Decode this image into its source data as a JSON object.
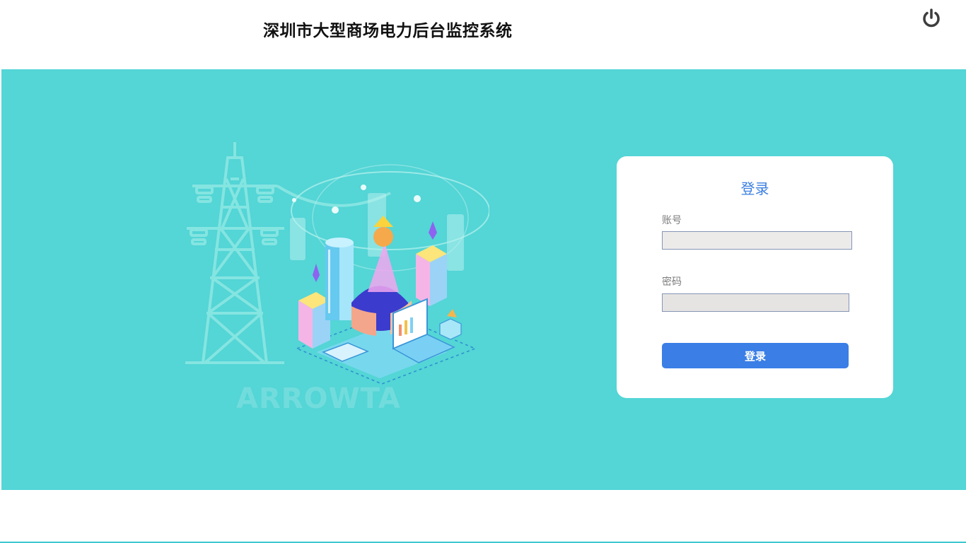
{
  "header": {
    "title": "深圳市大型商场电力后台监控系统",
    "power_icon": "power-icon"
  },
  "banner": {
    "background_color": "#54d5d6",
    "watermark_text": "ARROWTA"
  },
  "login": {
    "title": "登录",
    "account_label": "账号",
    "account_value": "",
    "password_label": "密码",
    "password_value": "",
    "submit_label": "登录",
    "accent_color": "#3a7ee6"
  }
}
